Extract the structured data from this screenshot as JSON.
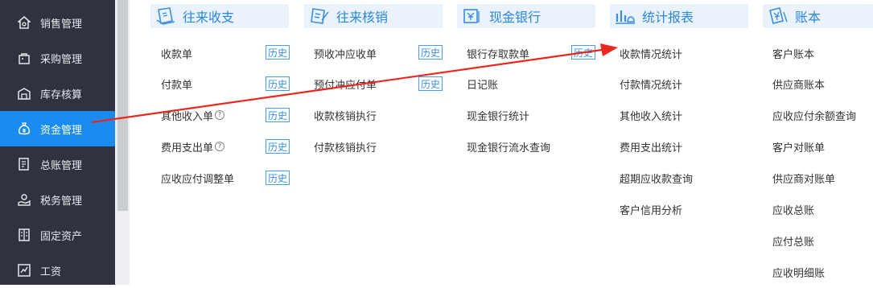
{
  "sidebar": {
    "items": [
      {
        "label": "销售管理"
      },
      {
        "label": "采购管理"
      },
      {
        "label": "库存核算"
      },
      {
        "label": "资金管理",
        "active": true
      },
      {
        "label": "总账管理"
      },
      {
        "label": "税务管理"
      },
      {
        "label": "固定资产"
      },
      {
        "label": "工资"
      }
    ]
  },
  "history_label": "历史",
  "columns": [
    {
      "title": "往来收支",
      "icon": "receipt-icon",
      "items": [
        "收款单",
        "付款单",
        "其他收入单",
        "费用支出单",
        "应收应付调整单"
      ]
    },
    {
      "title": "往来核销",
      "icon": "writeoff-icon",
      "items": [
        "预收冲应收单",
        "预付冲应付单",
        "收款核销执行",
        "付款核销执行"
      ]
    },
    {
      "title": "现金银行",
      "icon": "bank-icon",
      "items": [
        "银行存取款单",
        "日记账",
        "现金银行统计",
        "现金银行流水查询"
      ]
    },
    {
      "title": "统计报表",
      "icon": "report-icon",
      "items": [
        "收款情况统计",
        "付款情况统计",
        "其他收入统计",
        "费用支出统计",
        "超期应收款查询",
        "客户信用分析"
      ]
    },
    {
      "title": "账本",
      "icon": "ledger-icon",
      "items": [
        "客户账本",
        "供应商账本",
        "应收应付余额查询",
        "客户对账单",
        "供应商对账单",
        "应收总账",
        "应付总账",
        "应收明细账"
      ]
    }
  ],
  "help_mark": "?",
  "accent_color": "#1a8cf0",
  "annotation_color": "#e8281e"
}
